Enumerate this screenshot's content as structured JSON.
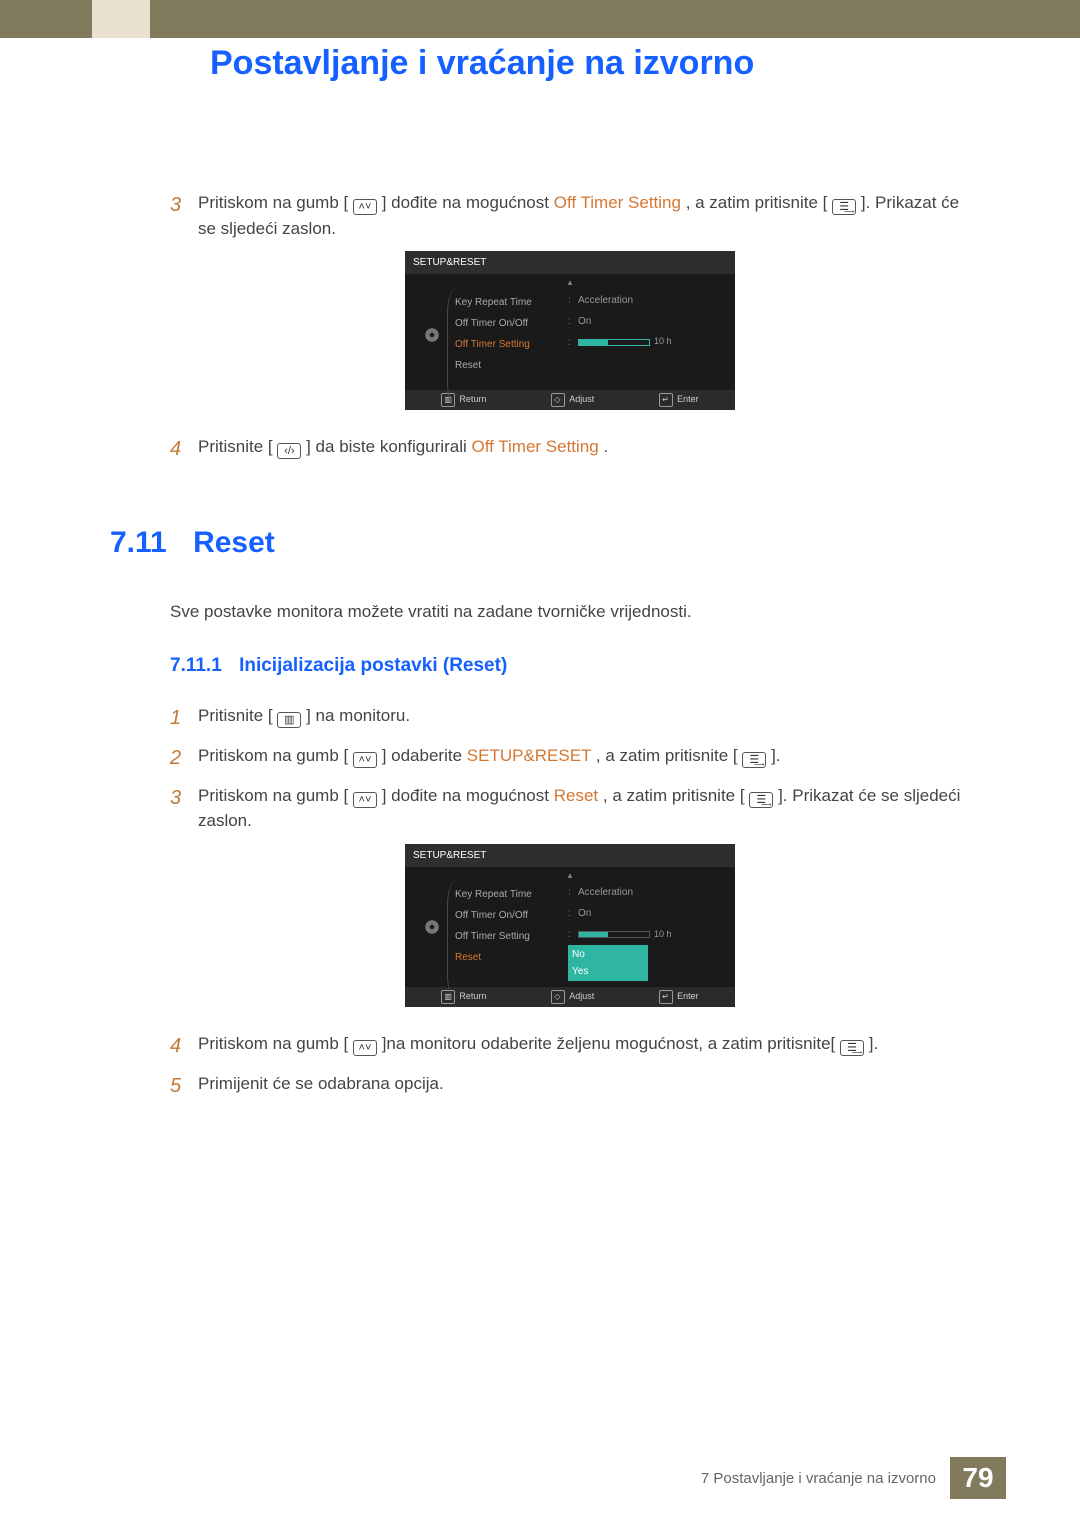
{
  "header": {
    "chapter_title": "Postavljanje i vraćanje na izvorno"
  },
  "steps_a": {
    "s3": {
      "pre": "Pritiskom na gumb [",
      "icon": "updown",
      "mid1": "] dođite na mogućnost ",
      "hl1": "Off Timer Setting",
      "mid2": ", a zatim pritisnite [",
      "icon2": "enter",
      "post": "]. Prikazat će se sljedeći zaslon."
    },
    "s4": {
      "pre": "Pritisnite [",
      "icon": "leftright",
      "mid1": "] da biste konfigurirali ",
      "hl1": "Off Timer Setting",
      "post": "."
    }
  },
  "section": {
    "num": "7.11",
    "title": "Reset",
    "intro": "Sve postavke monitora možete vratiti na zadane tvorničke vrijednosti."
  },
  "subsection": {
    "num": "7.11.1",
    "title": "Inicijalizacija postavki (Reset)"
  },
  "steps_b": {
    "s1": {
      "pre": "Pritisnite [ ",
      "icon": "menu",
      "post": " ] na monitoru."
    },
    "s2": {
      "pre": "Pritiskom na gumb [",
      "icon": "updown",
      "mid1": "] odaberite ",
      "hl1": "SETUP&RESET",
      "mid2": ", a zatim pritisnite [",
      "icon2": "enter",
      "post": "]."
    },
    "s3": {
      "pre": "Pritiskom na gumb [",
      "icon": "updown",
      "mid1": "] dođite na mogućnost ",
      "hl1": "Reset",
      "mid2": ", a zatim pritisnite [",
      "icon2": "enter",
      "post": "]. Prikazat će se sljedeći zaslon."
    },
    "s4": {
      "pre": "Pritiskom na gumb [",
      "icon": "updown",
      "mid1": "]na monitoru odaberite željenu mogućnost, a zatim pritisnite[",
      "icon2": "enter",
      "post": "]."
    },
    "s5": {
      "text": "Primijenit će se odabrana opcija."
    }
  },
  "osd": {
    "title": "SETUP&RESET",
    "items": [
      "Key Repeat Time",
      "Off Timer On/Off",
      "Off Timer Setting",
      "Reset"
    ],
    "values": {
      "key_repeat": "Acceleration",
      "onoff": "On",
      "timer": "10 h"
    },
    "reset_options": [
      "No",
      "Yes"
    ],
    "footer": {
      "return": "Return",
      "adjust": "Adjust",
      "enter": "Enter"
    }
  },
  "footer": {
    "chapter_line": "7 Postavljanje i vraćanje na izvorno",
    "page": "79"
  }
}
